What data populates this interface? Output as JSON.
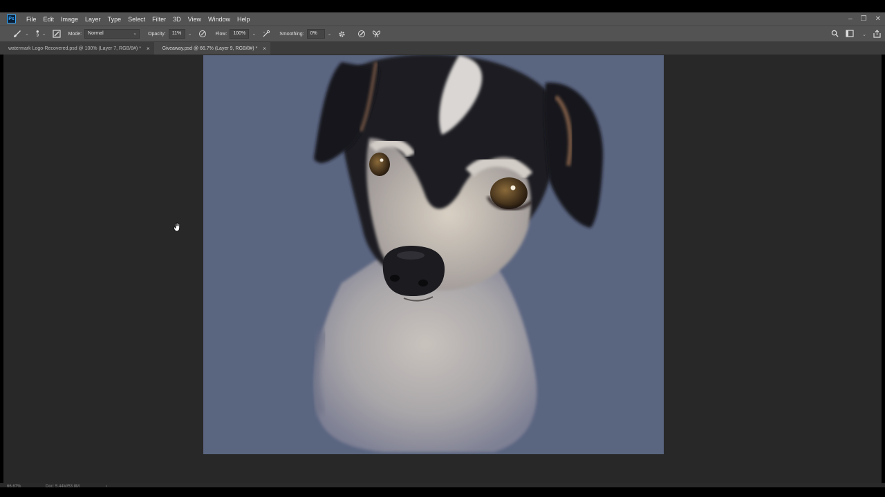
{
  "menu": {
    "app_icon": "Ps",
    "items": [
      "File",
      "Edit",
      "Image",
      "Layer",
      "Type",
      "Select",
      "Filter",
      "3D",
      "View",
      "Window",
      "Help"
    ],
    "window_controls": {
      "minimize": "–",
      "restore": "❐",
      "close": "✕"
    }
  },
  "options": {
    "brush_size": "9",
    "mode_label": "Mode:",
    "mode_value": "Normal",
    "opacity_label": "Opacity:",
    "opacity_value": "11%",
    "flow_label": "Flow:",
    "flow_value": "100%",
    "smoothing_label": "Smoothing:",
    "smoothing_value": "0%"
  },
  "tabs": [
    {
      "label": "watermark Logo-Recovered.psd @ 100% (Layer 7, RGB/8#) *",
      "close": "×",
      "active": false
    },
    {
      "label": "Giveaway.psd @ 66.7% (Layer 9, RGB/8#) *",
      "close": "×",
      "active": true
    }
  ],
  "status": {
    "zoom": "66.67%",
    "doc": "Doc: 5.44M/53.8M",
    "arrow": "›"
  },
  "colors": {
    "canvas_bg": "#5a6580",
    "workspace": "#282828",
    "panel": "#535353"
  }
}
